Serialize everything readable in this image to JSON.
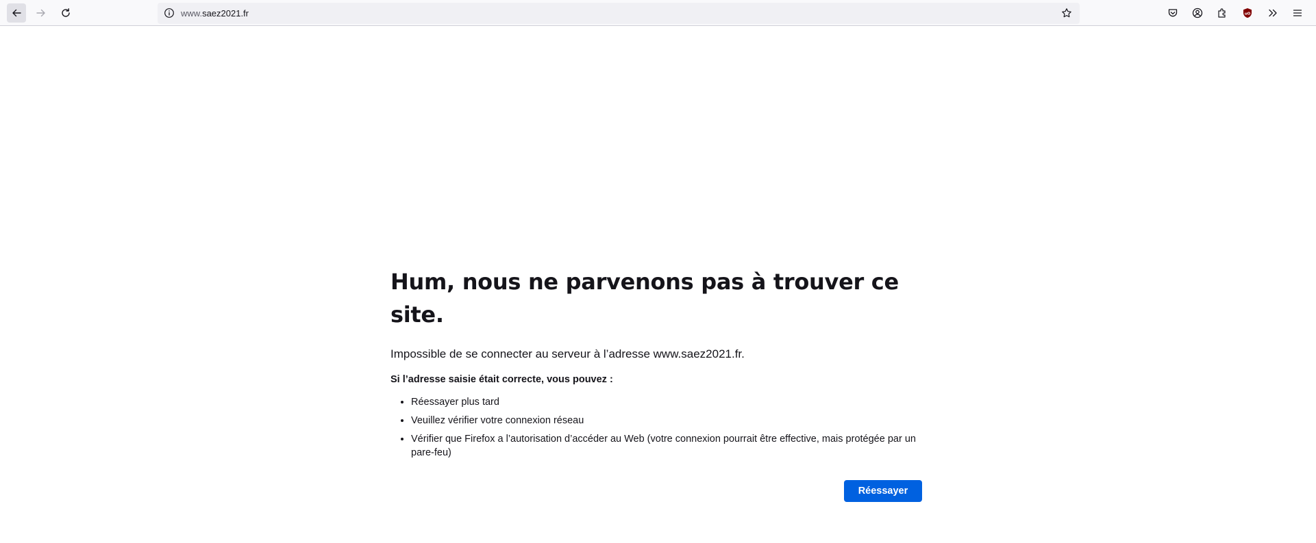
{
  "browser": {
    "url_prefix": "www.",
    "url_domain": "saez2021.fr",
    "back_label": "",
    "forward_label": "",
    "reload_label": ""
  },
  "toolbar_icons": [
    "back-arrow-icon",
    "forward-arrow-icon",
    "reload-icon",
    "info-icon",
    "bookmark-star-icon",
    "pocket-icon",
    "account-icon",
    "extensions-icon",
    "ublock-origin-icon",
    "overflow-chevrons-icon",
    "hamburger-menu-icon"
  ],
  "error_page": {
    "title": "Hum, nous ne parvenons pas à trouver ce site.",
    "description": "Impossible de se connecter au serveur à l’adresse www.saez2021.fr.",
    "subheading": "Si l’adresse saisie était correcte, vous pouvez :",
    "suggestions": [
      "Réessayer plus tard",
      "Veuillez vérifier votre connexion réseau",
      "Vérifier que Firefox a l’autorisation d’accéder au Web (votre connexion pourrait être effective, mais protégée par un pare-feu)"
    ],
    "retry_label": "Réessayer"
  },
  "colors": {
    "primary_button": "#0061e0",
    "ublock_badge": "#800000",
    "toolbar_bg": "#f9f9fb",
    "urlbar_bg": "#f0f0f4"
  }
}
